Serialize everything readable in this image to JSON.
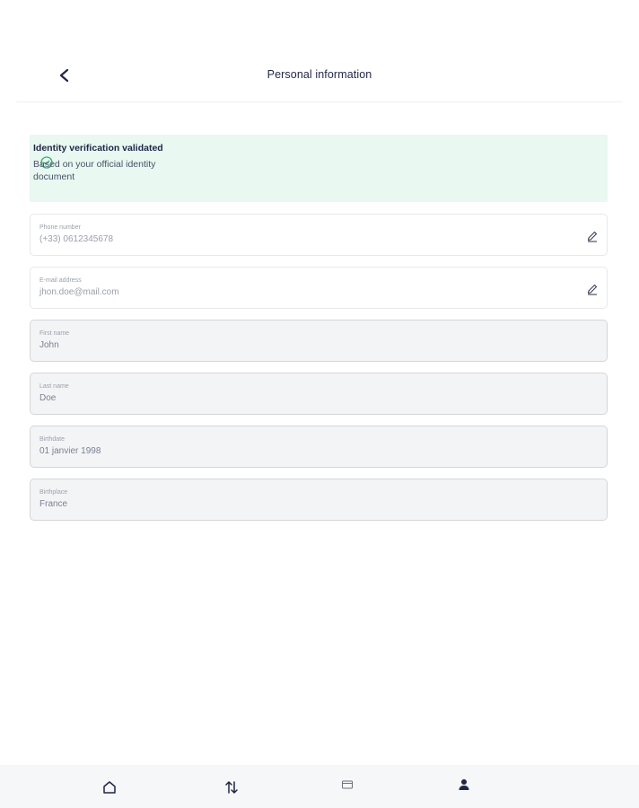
{
  "header": {
    "title": "Personal information",
    "back_icon": "chevron-left-icon"
  },
  "banner": {
    "title": "Identity verification validated",
    "text": "Based on your official identity document",
    "icon": "check-circle-icon",
    "color": "#e9f8f0",
    "icon_color": "#2bb673"
  },
  "fields": [
    {
      "label": "Phone number",
      "value": "(+33) 0612345678",
      "editable": true
    },
    {
      "label": "E-mail address",
      "value": "jhon.doe@mail.com",
      "editable": true
    },
    {
      "label": "First name",
      "value": "John",
      "editable": false
    },
    {
      "label": "Last name",
      "value": "Doe",
      "editable": false
    },
    {
      "label": "Birthdate",
      "value": "01 janvier 1998",
      "editable": false
    },
    {
      "label": "Birthplace",
      "value": "France",
      "editable": false
    }
  ],
  "bottom_nav": {
    "items": [
      {
        "icon": "home-icon"
      },
      {
        "icon": "transfer-arrows-icon"
      },
      {
        "icon": "wallet-icon"
      },
      {
        "icon": "user-icon",
        "active": true
      }
    ]
  }
}
